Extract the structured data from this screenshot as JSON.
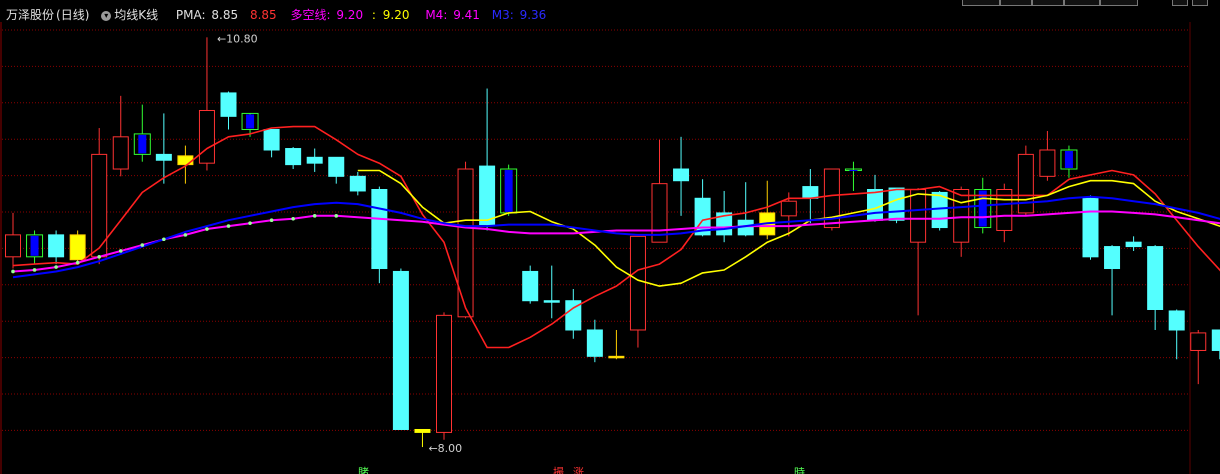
{
  "header": {
    "stock_name": "万泽股份",
    "period": "(日线)",
    "indicator_menu": "均线K线",
    "pma_label": "PMA:",
    "pma_value1": "8.85",
    "pma_value2": "8.85",
    "dkx_label": "多空线:",
    "dkx_value1": "9.20",
    "dkx_value2": "9.20",
    "m4_label": "M4:",
    "m4_value": "9.41",
    "m3_label": "M3:",
    "m3_value": "9.36"
  },
  "colors": {
    "background": "#000000",
    "grid": "#8b0000",
    "up": "#ff3232",
    "down": "#54ffff",
    "yellow": "#ffff00",
    "blue_fill": "#0000ff",
    "pma": "#ff2020",
    "dkx": "#ffff00",
    "m4": "#ff00ff",
    "m3": "#0000ff"
  },
  "chart_data": {
    "type": "candlestick",
    "title": "万泽股份(日线)",
    "ylim": [
      7.85,
      10.85
    ],
    "annotations": {
      "high_label": "10.80",
      "low_label": "8.00",
      "bottom_marks": [
        "賭",
        "撮",
        "涨",
        "時"
      ]
    },
    "candles": [
      {
        "o": 9.3,
        "c": 9.45,
        "h": 9.6,
        "l": 9.22,
        "s": "up"
      },
      {
        "o": 9.45,
        "c": 9.3,
        "h": 9.48,
        "l": 9.25,
        "s": "blue"
      },
      {
        "o": 9.45,
        "c": 9.3,
        "h": 9.48,
        "l": 9.25,
        "s": "down"
      },
      {
        "o": 9.28,
        "c": 9.45,
        "h": 9.48,
        "l": 9.25,
        "s": "yellow"
      },
      {
        "o": 9.3,
        "c": 10.0,
        "h": 10.18,
        "l": 9.25,
        "s": "up"
      },
      {
        "o": 9.9,
        "c": 10.12,
        "h": 10.4,
        "l": 9.85,
        "s": "up"
      },
      {
        "o": 10.14,
        "c": 10.0,
        "h": 10.34,
        "l": 9.95,
        "s": "blue"
      },
      {
        "o": 10.0,
        "c": 9.96,
        "h": 10.28,
        "l": 9.8,
        "s": "down"
      },
      {
        "o": 9.93,
        "c": 9.99,
        "h": 10.06,
        "l": 9.8,
        "s": "yellow"
      },
      {
        "o": 9.94,
        "c": 10.3,
        "h": 10.8,
        "l": 9.89,
        "s": "up"
      },
      {
        "o": 10.42,
        "c": 10.26,
        "h": 10.43,
        "l": 10.17,
        "s": "down"
      },
      {
        "o": 10.28,
        "c": 10.17,
        "h": 10.27,
        "l": 10.12,
        "s": "blue"
      },
      {
        "o": 10.17,
        "c": 10.03,
        "h": 10.17,
        "l": 9.98,
        "s": "down"
      },
      {
        "o": 10.04,
        "c": 9.93,
        "h": 10.05,
        "l": 9.9,
        "s": "down"
      },
      {
        "o": 9.98,
        "c": 9.94,
        "h": 10.04,
        "l": 9.88,
        "s": "down"
      },
      {
        "o": 9.98,
        "c": 9.85,
        "h": 9.98,
        "l": 9.8,
        "s": "down"
      },
      {
        "o": 9.85,
        "c": 9.75,
        "h": 9.88,
        "l": 9.72,
        "s": "down"
      },
      {
        "o": 9.76,
        "c": 9.22,
        "h": 9.78,
        "l": 9.12,
        "s": "down"
      },
      {
        "o": 9.2,
        "c": 8.12,
        "h": 9.22,
        "l": 8.12,
        "s": "down"
      },
      {
        "o": 8.12,
        "c": 8.1,
        "h": 8.12,
        "l": 8.0,
        "s": "flat"
      },
      {
        "o": 8.1,
        "c": 8.9,
        "h": 8.92,
        "l": 8.05,
        "s": "up"
      },
      {
        "o": 8.89,
        "c": 9.9,
        "h": 9.95,
        "l": 8.88,
        "s": "up"
      },
      {
        "o": 9.92,
        "c": 9.52,
        "h": 10.45,
        "l": 9.48,
        "s": "down"
      },
      {
        "o": 9.9,
        "c": 9.6,
        "h": 9.93,
        "l": 9.58,
        "s": "blue"
      },
      {
        "o": 9.2,
        "c": 9.0,
        "h": 9.24,
        "l": 8.98,
        "s": "down"
      },
      {
        "o": 9.0,
        "c": 9.0,
        "h": 9.24,
        "l": 8.88,
        "s": "down"
      },
      {
        "o": 9.0,
        "c": 8.8,
        "h": 9.08,
        "l": 8.74,
        "s": "down"
      },
      {
        "o": 8.8,
        "c": 8.62,
        "h": 8.87,
        "l": 8.58,
        "s": "down"
      },
      {
        "o": 8.62,
        "c": 8.62,
        "h": 8.8,
        "l": 8.6,
        "s": "yellow"
      },
      {
        "o": 8.8,
        "c": 9.44,
        "h": 9.44,
        "l": 8.68,
        "s": "up"
      },
      {
        "o": 9.4,
        "c": 9.8,
        "h": 10.1,
        "l": 9.4,
        "s": "up"
      },
      {
        "o": 9.9,
        "c": 9.82,
        "h": 10.12,
        "l": 9.58,
        "s": "down"
      },
      {
        "o": 9.7,
        "c": 9.45,
        "h": 9.83,
        "l": 9.44,
        "s": "down"
      },
      {
        "o": 9.6,
        "c": 9.45,
        "h": 9.75,
        "l": 9.4,
        "s": "down"
      },
      {
        "o": 9.55,
        "c": 9.45,
        "h": 9.81,
        "l": 9.44,
        "s": "down"
      },
      {
        "o": 9.45,
        "c": 9.6,
        "h": 9.82,
        "l": 9.42,
        "s": "yellow"
      },
      {
        "o": 9.58,
        "c": 9.68,
        "h": 9.74,
        "l": 9.44,
        "s": "up"
      },
      {
        "o": 9.78,
        "c": 9.7,
        "h": 9.9,
        "l": 9.53,
        "s": "down"
      },
      {
        "o": 9.5,
        "c": 9.9,
        "h": 9.9,
        "l": 9.48,
        "s": "up"
      },
      {
        "o": 9.9,
        "c": 9.9,
        "h": 9.95,
        "l": 9.75,
        "s": "blue"
      },
      {
        "o": 9.76,
        "c": 9.55,
        "h": 9.86,
        "l": 9.54,
        "s": "down"
      },
      {
        "o": 9.77,
        "c": 9.55,
        "h": 9.77,
        "l": 9.53,
        "s": "down"
      },
      {
        "o": 9.4,
        "c": 9.76,
        "h": 9.77,
        "l": 8.9,
        "s": "up"
      },
      {
        "o": 9.74,
        "c": 9.5,
        "h": 9.75,
        "l": 9.48,
        "s": "down"
      },
      {
        "o": 9.4,
        "c": 9.76,
        "h": 9.78,
        "l": 9.3,
        "s": "up"
      },
      {
        "o": 9.76,
        "c": 9.5,
        "h": 9.84,
        "l": 9.46,
        "s": "blue"
      },
      {
        "o": 9.48,
        "c": 9.76,
        "h": 9.8,
        "l": 9.4,
        "s": "up"
      },
      {
        "o": 9.6,
        "c": 10.0,
        "h": 10.06,
        "l": 9.58,
        "s": "up"
      },
      {
        "o": 9.85,
        "c": 10.03,
        "h": 10.16,
        "l": 9.82,
        "s": "up"
      },
      {
        "o": 10.03,
        "c": 9.9,
        "h": 10.06,
        "l": 9.84,
        "s": "blue"
      },
      {
        "o": 9.7,
        "c": 9.3,
        "h": 9.72,
        "l": 9.28,
        "s": "down"
      },
      {
        "o": 9.37,
        "c": 9.22,
        "h": 9.38,
        "l": 8.9,
        "s": "down"
      },
      {
        "o": 9.4,
        "c": 9.37,
        "h": 9.44,
        "l": 9.34,
        "s": "down"
      },
      {
        "o": 9.37,
        "c": 8.94,
        "h": 9.38,
        "l": 8.8,
        "s": "down"
      },
      {
        "o": 8.93,
        "c": 8.8,
        "h": 8.94,
        "l": 8.6,
        "s": "down"
      },
      {
        "o": 8.78,
        "c": 8.66,
        "h": 8.8,
        "l": 8.43,
        "s": "up"
      },
      {
        "o": 8.8,
        "c": 8.66,
        "h": 8.8,
        "l": 8.6,
        "s": "down"
      },
      {
        "o": 8.78,
        "c": 8.66,
        "h": 8.82,
        "l": 8.6,
        "s": "down"
      },
      {
        "o": 8.74,
        "c": 8.54,
        "h": 8.74,
        "l": 8.5,
        "s": "down"
      },
      {
        "o": 8.48,
        "c": 8.56,
        "h": 8.62,
        "l": 8.46,
        "s": "up"
      },
      {
        "o": 8.56,
        "c": 8.58,
        "h": 8.64,
        "l": 8.54,
        "s": "up"
      },
      {
        "o": 8.6,
        "c": 8.73,
        "h": 8.96,
        "l": 8.4,
        "s": "up"
      }
    ],
    "series": [
      {
        "name": "PMA",
        "color": "#ff2020",
        "values": [
          9.24,
          9.25,
          9.26,
          9.25,
          9.36,
          9.55,
          9.74,
          9.84,
          9.92,
          10.04,
          10.12,
          10.14,
          10.18,
          10.19,
          10.19,
          10.1,
          10.0,
          9.94,
          9.85,
          9.59,
          9.4,
          8.95,
          8.68,
          8.68,
          8.75,
          8.84,
          8.95,
          9.03,
          9.1,
          9.21,
          9.25,
          9.35,
          9.55,
          9.58,
          9.6,
          9.64,
          9.7,
          9.7,
          9.72,
          9.73,
          9.74,
          9.76,
          9.76,
          9.78,
          9.72,
          9.72,
          9.72,
          9.72,
          9.72,
          9.83,
          9.86,
          9.89,
          9.86,
          9.73,
          9.55,
          9.37,
          9.21,
          9.02,
          8.86,
          8.75,
          8.72,
          8.7,
          8.71
        ]
      },
      {
        "name": "多空线",
        "color": "#ffff00",
        "values": [
          null,
          null,
          null,
          null,
          null,
          null,
          null,
          null,
          null,
          null,
          null,
          null,
          null,
          null,
          null,
          null,
          9.89,
          9.89,
          9.8,
          9.64,
          9.53,
          9.55,
          9.55,
          9.6,
          9.61,
          9.54,
          9.49,
          9.38,
          9.23,
          9.14,
          9.1,
          9.12,
          9.19,
          9.21,
          9.3,
          9.4,
          9.46,
          9.55,
          9.57,
          9.6,
          9.63,
          9.69,
          9.73,
          9.72,
          9.67,
          9.7,
          9.69,
          9.69,
          9.72,
          9.78,
          9.82,
          9.82,
          9.8,
          9.68,
          9.61,
          9.56,
          9.51,
          9.45,
          9.38,
          9.3,
          9.22,
          9.17,
          9.13
        ]
      },
      {
        "name": "M4",
        "color": "#ff00ff",
        "values": [
          9.2,
          9.21,
          9.23,
          9.26,
          9.3,
          9.34,
          9.38,
          9.42,
          9.45,
          9.49,
          9.51,
          9.53,
          9.55,
          9.56,
          9.58,
          9.58,
          9.57,
          9.56,
          9.55,
          9.54,
          9.52,
          9.5,
          9.49,
          9.47,
          9.46,
          9.46,
          9.46,
          9.47,
          9.48,
          9.48,
          9.48,
          9.49,
          9.5,
          9.5,
          9.51,
          9.51,
          9.51,
          9.52,
          9.53,
          9.54,
          9.55,
          9.56,
          9.56,
          9.56,
          9.57,
          9.57,
          9.58,
          9.58,
          9.59,
          9.6,
          9.61,
          9.61,
          9.6,
          9.59,
          9.57,
          9.55,
          9.53,
          9.51,
          9.49,
          9.47,
          9.45,
          9.43,
          9.42
        ]
      },
      {
        "name": "M3",
        "color": "#0000ff",
        "values": [
          9.16,
          9.18,
          9.2,
          9.23,
          9.27,
          9.32,
          9.37,
          9.42,
          9.47,
          9.51,
          9.55,
          9.58,
          9.61,
          9.64,
          9.66,
          9.67,
          9.66,
          9.63,
          9.6,
          9.56,
          9.53,
          9.51,
          9.51,
          9.52,
          9.52,
          9.52,
          9.5,
          9.48,
          9.46,
          9.45,
          9.45,
          9.46,
          9.48,
          9.49,
          9.51,
          9.53,
          9.54,
          9.55,
          9.56,
          9.58,
          9.6,
          9.61,
          9.62,
          9.63,
          9.64,
          9.65,
          9.66,
          9.67,
          9.68,
          9.7,
          9.71,
          9.7,
          9.68,
          9.66,
          9.63,
          9.6,
          9.56,
          9.53,
          9.49,
          9.46,
          9.44,
          9.42,
          9.38
        ]
      }
    ]
  }
}
